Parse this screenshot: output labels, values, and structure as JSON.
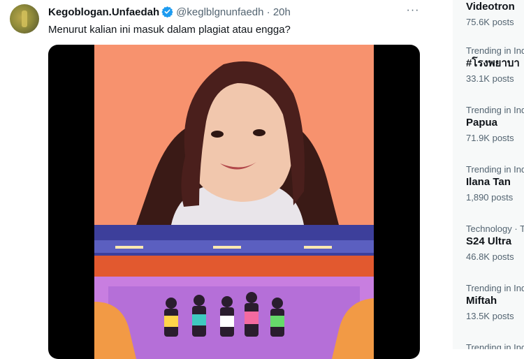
{
  "tweet": {
    "display_name": "Kegoblogan.Unfaedah",
    "handle": "@keglblgnunfaedh",
    "separator": "·",
    "time": "20h",
    "more": "···",
    "text": "Menurut kalian ini masuk dalam plagiat atau engga?",
    "verified_color": "#1d9bf0",
    "media": {
      "type": "video-still",
      "upper_bg": "#f7926e",
      "lower_bg": "#3d3f9b"
    }
  },
  "trends": [
    {
      "meta": "",
      "topic": "Videotron",
      "count": "75.6K posts"
    },
    {
      "meta": "Trending in Ind",
      "topic": "#โรงพยาบา",
      "count": "33.1K posts"
    },
    {
      "meta": "Trending in Ind",
      "topic": "Papua",
      "count": "71.9K posts"
    },
    {
      "meta": "Trending in Ind",
      "topic": "Ilana Tan",
      "count": "1,890 posts"
    },
    {
      "meta": "Technology · T",
      "topic": "S24 Ultra",
      "count": "46.8K posts"
    },
    {
      "meta": "Trending in Ind",
      "topic": "Miftah",
      "count": "13.5K posts"
    },
    {
      "meta": "Trending in Ind",
      "topic": "",
      "count": ""
    }
  ]
}
